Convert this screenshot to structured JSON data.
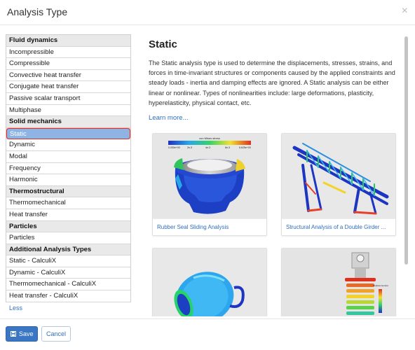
{
  "dialog": {
    "title": "Analysis Type",
    "close_symbol": "×"
  },
  "sidebar": {
    "groups": [
      {
        "label": "Fluid dynamics",
        "items": [
          "Incompressible",
          "Compressible",
          "Convective heat transfer",
          "Conjugate heat transfer",
          "Passive scalar transport",
          "Multiphase"
        ]
      },
      {
        "label": "Solid mechanics",
        "items": [
          "Static",
          "Dynamic",
          "Modal",
          "Frequency",
          "Harmonic"
        ]
      },
      {
        "label": "Thermostructural",
        "items": [
          "Thermomechanical",
          "Heat transfer"
        ]
      },
      {
        "label": "Particles",
        "items": [
          "Particles"
        ]
      },
      {
        "label": "Additional Analysis Types",
        "items": [
          "Static - CalculiX",
          "Dynamic - CalculiX",
          "Thermomechanical - CalculiX",
          "Heat transfer - CalculiX"
        ]
      }
    ],
    "selected": "Static",
    "less_label": "Less"
  },
  "content": {
    "title": "Static",
    "description": "The Static analysis type is used to determine the displacements, stresses, strains, and forces in time-invariant structures or components caused by the applied constraints and steady loads - inertia and damping effects are ignored. A Static analysis can be either linear or nonlinear. Types of nonlinearities include: large deformations, plasticity, hyperelasticity, physical contact, etc.",
    "learn_more": "Learn more...",
    "cards": [
      {
        "label": "Rubber Seal Sliding Analysis",
        "legend_title": "von Mises stress",
        "legend_ticks": [
          "0.000e+00",
          "2e-3",
          "4e-3",
          "6e-3",
          "6.625e+00"
        ]
      },
      {
        "label": "Structural Analysis of a Double Girder ..."
      },
      {
        "label": ""
      },
      {
        "label": "",
        "legend_title": "displacement(m)"
      }
    ]
  },
  "footer": {
    "save_label": "Save",
    "cancel_label": "Cancel"
  },
  "colors": {
    "accent": "#3a76c4",
    "link": "#2f6fbf",
    "selected_bg": "#8fb4e4",
    "selected_border": "#d9342b"
  },
  "icons": {
    "close": "close-icon",
    "save": "floppy-disk-icon"
  }
}
